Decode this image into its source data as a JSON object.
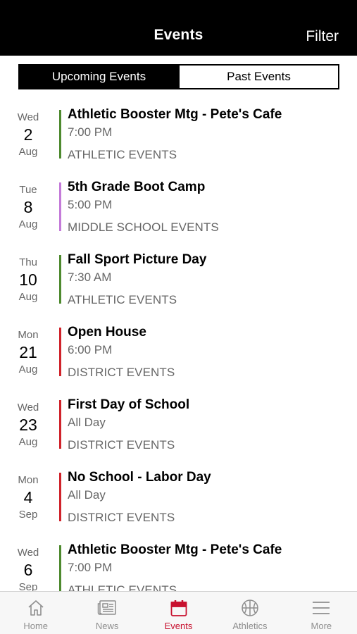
{
  "header": {
    "title": "Events",
    "filter_label": "Filter"
  },
  "segments": {
    "upcoming": "Upcoming Events",
    "past": "Past Events"
  },
  "colors": {
    "athletic": "#4e8a2f",
    "middle_school": "#c47bd9",
    "district": "#d0232b",
    "tab_active": "#c8102e",
    "tab_inactive": "#8e8e8e"
  },
  "events": [
    {
      "dow": "Wed",
      "day": "2",
      "month": "Aug",
      "title": "Athletic Booster Mtg - Pete's Cafe",
      "time": "7:00 PM",
      "category": "ATHLETIC EVENTS",
      "color": "#4e8a2f"
    },
    {
      "dow": "Tue",
      "day": "8",
      "month": "Aug",
      "title": "5th Grade Boot Camp",
      "time": "5:00 PM",
      "category": "MIDDLE SCHOOL EVENTS",
      "color": "#c47bd9"
    },
    {
      "dow": "Thu",
      "day": "10",
      "month": "Aug",
      "title": "Fall Sport Picture Day",
      "time": "7:30 AM",
      "category": "ATHLETIC EVENTS",
      "color": "#4e8a2f"
    },
    {
      "dow": "Mon",
      "day": "21",
      "month": "Aug",
      "title": "Open House",
      "time": "6:00 PM",
      "category": "DISTRICT EVENTS",
      "color": "#d0232b"
    },
    {
      "dow": "Wed",
      "day": "23",
      "month": "Aug",
      "title": "First Day of School",
      "time": "All Day",
      "category": "DISTRICT EVENTS",
      "color": "#d0232b"
    },
    {
      "dow": "Mon",
      "day": "4",
      "month": "Sep",
      "title": "No School - Labor Day",
      "time": "All Day",
      "category": "DISTRICT EVENTS",
      "color": "#d0232b"
    },
    {
      "dow": "Wed",
      "day": "6",
      "month": "Sep",
      "title": "Athletic Booster Mtg - Pete's Cafe",
      "time": "7:00 PM",
      "category": "ATHLETIC EVENTS",
      "color": "#4e8a2f"
    }
  ],
  "tabs": [
    {
      "label": "Home",
      "icon": "home-icon",
      "active": false
    },
    {
      "label": "News",
      "icon": "news-icon",
      "active": false
    },
    {
      "label": "Events",
      "icon": "calendar-icon",
      "active": true
    },
    {
      "label": "Athletics",
      "icon": "basketball-icon",
      "active": false
    },
    {
      "label": "More",
      "icon": "menu-icon",
      "active": false
    }
  ]
}
